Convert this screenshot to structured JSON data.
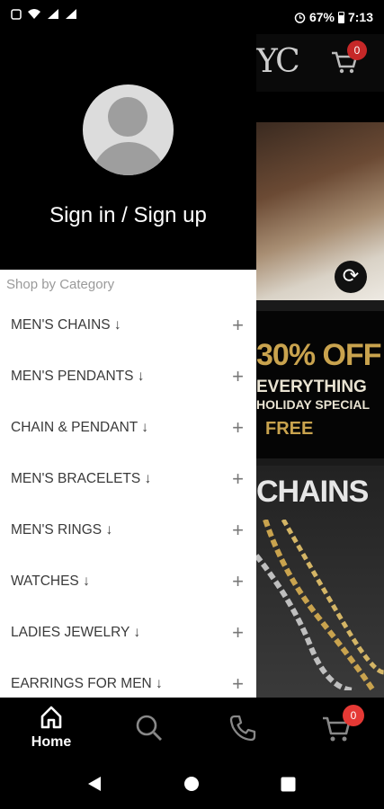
{
  "status_bar": {
    "battery": "67%",
    "time": "7:13"
  },
  "background_app": {
    "logo_fragment": "YC",
    "cart_count": "0",
    "promo_big": "30% OFF",
    "promo_line2": "EVERYTHING",
    "promo_line3": "HOLIDAY SPECIAL",
    "promo_free": "FREE",
    "chains_title": "CHAINS"
  },
  "drawer": {
    "signin_label": "Sign in / Sign up",
    "category_heading": "Shop by Category",
    "categories": [
      {
        "label": "MEN'S CHAINS ↓"
      },
      {
        "label": "MEN'S PENDANTS ↓"
      },
      {
        "label": "CHAIN & PENDANT ↓"
      },
      {
        "label": "MEN'S BRACELETS ↓"
      },
      {
        "label": "MEN'S RINGS ↓"
      },
      {
        "label": "WATCHES ↓"
      },
      {
        "label": "LADIES JEWELRY ↓"
      },
      {
        "label": "EARRINGS FOR MEN ↓"
      }
    ],
    "expand_symbol": "+"
  },
  "bottom_nav": {
    "home_label": "Home",
    "cart_count": "0"
  },
  "colors": {
    "badge_red": "#e53935",
    "gold": "#c9a34e"
  }
}
